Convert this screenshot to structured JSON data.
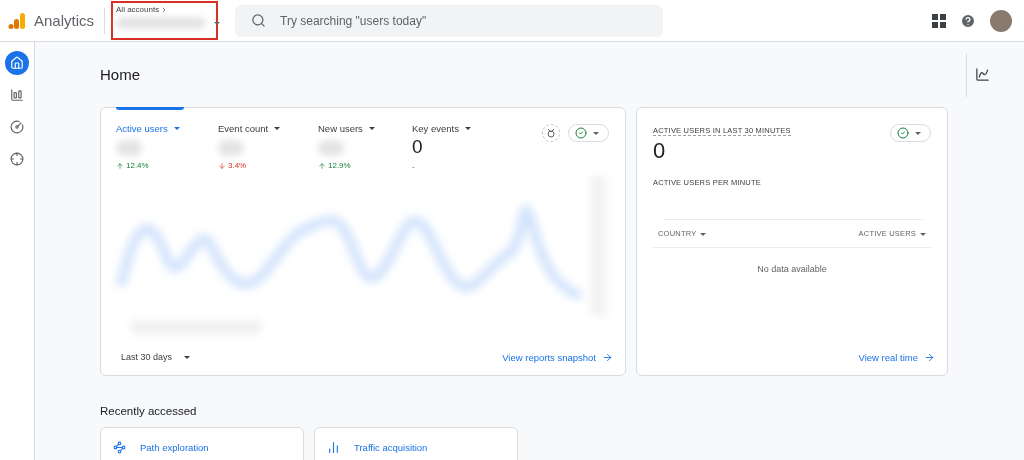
{
  "header": {
    "product": "Analytics",
    "account": {
      "breadcrumb": "All accounts",
      "highlighted": true
    },
    "search": {
      "placeholder": "Try searching \"users today\""
    }
  },
  "sidebar": {
    "items": [
      {
        "kind": "home",
        "selected": true
      },
      {
        "kind": "reports",
        "selected": false
      },
      {
        "kind": "explore",
        "selected": false
      },
      {
        "kind": "advertising",
        "selected": false
      }
    ]
  },
  "page": {
    "title": "Home"
  },
  "overview": {
    "metrics": [
      {
        "label": "Active users",
        "selected": true,
        "blurred": true,
        "change": "12.4%",
        "increase": true
      },
      {
        "label": "Event count",
        "selected": false,
        "blurred": true,
        "change": "3.4%",
        "increase": false
      },
      {
        "label": "New users",
        "selected": false,
        "blurred": true,
        "change": "12.9%",
        "increase": true
      },
      {
        "label": "Key events",
        "selected": false,
        "blurred": false,
        "value": "0",
        "note": "-"
      }
    ],
    "period": "Last 30 days",
    "link": "View reports snapshot"
  },
  "realtime": {
    "title": "ACTIVE USERS IN LAST 30 MINUTES",
    "value": "0",
    "subtitle": "ACTIVE USERS PER MINUTE",
    "columns": [
      "COUNTRY",
      "ACTIVE USERS"
    ],
    "empty": "No data available",
    "link": "View real time"
  },
  "recent": {
    "title": "Recently accessed",
    "items": [
      {
        "kind": "exploration",
        "label": "Path exploration"
      },
      {
        "kind": "report",
        "label": "Traffic acquisition"
      }
    ]
  }
}
